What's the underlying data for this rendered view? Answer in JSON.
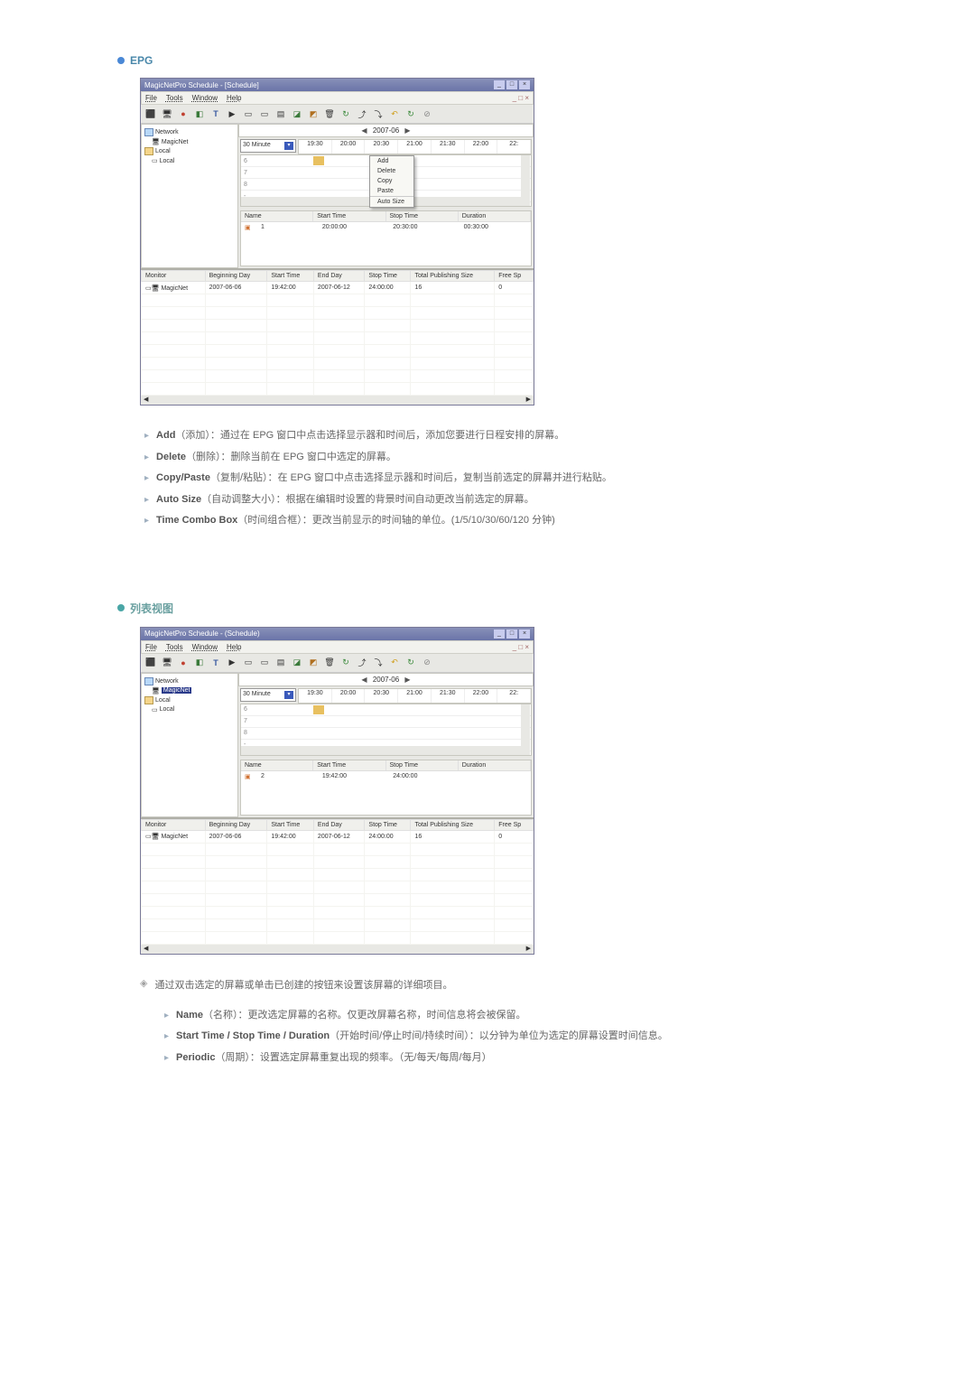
{
  "sections": {
    "epg_title": "EPG",
    "listview_title": "列表视图"
  },
  "app1": {
    "title": "MagicNetPro Schedule - [Schedule]",
    "menus": [
      "File",
      "Tools",
      "Window",
      "Help"
    ],
    "date": "2007-06",
    "time_select": "30 Minute",
    "time_ticks": [
      "19:30",
      "20:00",
      "20:30",
      "21:00",
      "21:30",
      "22:00",
      "22:"
    ],
    "tree": [
      "Network",
      "MagicNet",
      "Local",
      "Local"
    ],
    "grid_rows": [
      "6",
      "7",
      "8"
    ],
    "ctx": [
      "Add",
      "Delete",
      "Copy",
      "Paste",
      "Auto Size"
    ],
    "mid_head": [
      "Name",
      "Start Time",
      "Stop Time",
      "Duration"
    ],
    "mid_row": [
      "1",
      "20:00:00",
      "20:30:00",
      "00:30:00"
    ],
    "bottom_head": [
      "Monitor",
      "Beginning Day",
      "Start Time",
      "End Day",
      "Stop Time",
      "Total Publishing Size",
      "Free Sp"
    ],
    "bottom_row": [
      "MagicNet",
      "2007-06-06",
      "19:42:00",
      "2007-06-12",
      "24:00:00",
      "16",
      "0"
    ]
  },
  "app2": {
    "title": "MagicNetPro Schedule - (Schedule)",
    "menus": [
      "File",
      "Tools",
      "Window",
      "Help"
    ],
    "date": "2007-06",
    "time_select": "30 Minute",
    "time_ticks": [
      "19:30",
      "20:00",
      "20:30",
      "21:00",
      "21:30",
      "22:00",
      "22:"
    ],
    "tree": [
      "Network",
      "MagicNet",
      "Local",
      "Local"
    ],
    "grid_rows": [
      "6",
      "7",
      "8"
    ],
    "mid_head": [
      "Name",
      "Start Time",
      "Stop Time",
      "Duration"
    ],
    "mid_row": [
      "2",
      "19:42:00",
      "24:00:00",
      ""
    ],
    "bottom_head": [
      "Monitor",
      "Beginning Day",
      "Start Time",
      "End Day",
      "Stop Time",
      "Total Publishing Size",
      "Free Sp"
    ],
    "bottom_row": [
      "MagicNet",
      "2007-06-06",
      "19:42:00",
      "2007-06-12",
      "24:00:00",
      "16",
      "0"
    ]
  },
  "epg_desc": [
    {
      "b": "Add",
      "t": "（添加）：通过在 EPG 窗口中点击选择显示器和时间后，添加您要进行日程安排的屏幕。"
    },
    {
      "b": "Delete",
      "t": "（删除）：删除当前在 EPG 窗口中选定的屏幕。"
    },
    {
      "b": "Copy/Paste",
      "t": "（复制/粘贴）：在 EPG 窗口中点击选择显示器和时间后，复制当前选定的屏幕并进行粘贴。"
    },
    {
      "b": "Auto Size",
      "t": "（自动调整大小）：根据在编辑时设置的背景时间自动更改当前选定的屏幕。"
    },
    {
      "b": "Time Combo Box",
      "t": "（时间组合框）：更改当前显示的时间轴的单位。(1/5/10/30/60/120 分钟)"
    }
  ],
  "listview_note": "通过双击选定的屏幕或单击已创建的按钮来设置该屏幕的详细项目。",
  "listview_desc": [
    {
      "b": "Name",
      "t": "（名称）：更改选定屏幕的名称。仅更改屏幕名称，时间信息将会被保留。"
    },
    {
      "b": "Start Time / Stop Time / Duration",
      "t": "（开始时间/停止时间/持续时间）：以分钟为单位为选定的屏幕设置时间信息。"
    },
    {
      "b": "Periodic",
      "t": "（周期）：设置选定屏幕重复出现的频率。（无/每天/每周/每月）"
    }
  ]
}
